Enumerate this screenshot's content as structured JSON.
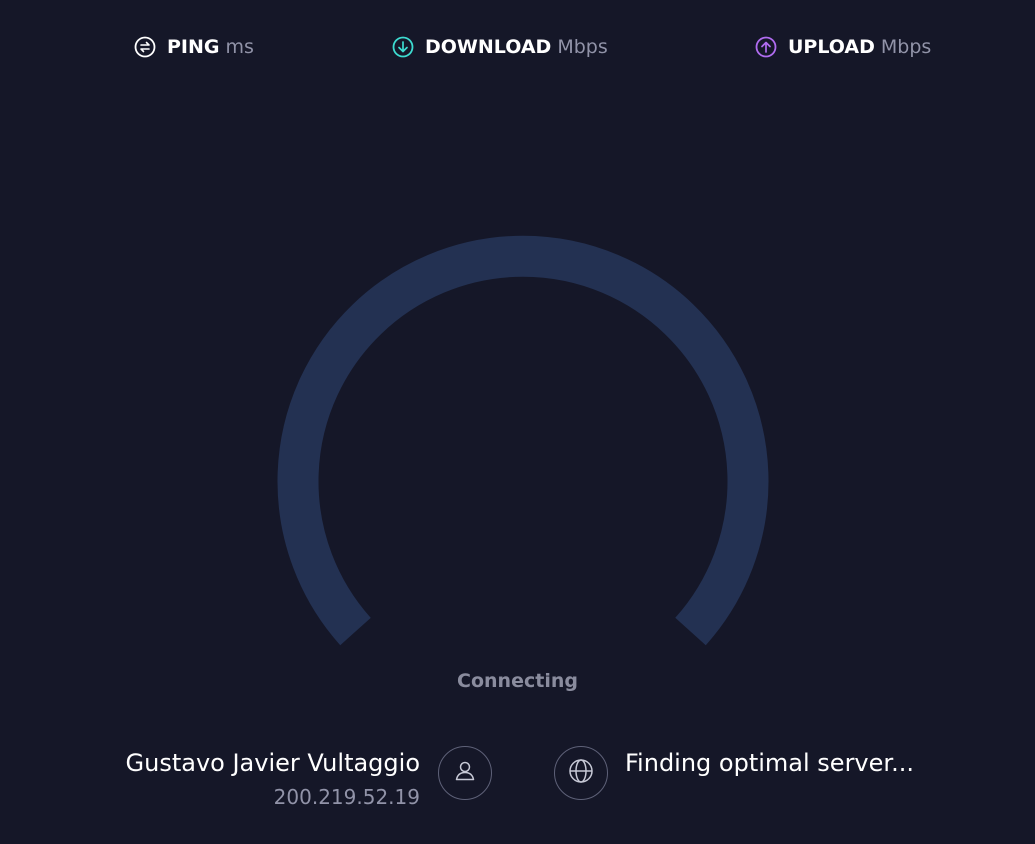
{
  "metrics": {
    "ping": {
      "label": "PING",
      "unit": "ms",
      "icon": "ping-icon",
      "color": "#ffffff"
    },
    "download": {
      "label": "DOWNLOAD",
      "unit": "Mbps",
      "icon": "download-icon",
      "color": "#3ddbd0"
    },
    "upload": {
      "label": "UPLOAD",
      "unit": "Mbps",
      "icon": "upload-icon",
      "color": "#b06cf0"
    }
  },
  "gauge": {
    "track_color": "#233152",
    "status": "Connecting"
  },
  "connection": {
    "isp_name": "Gustavo Javier Vultaggio",
    "ip_address": "200.219.52.19",
    "user_icon": "user-icon",
    "server_icon": "globe-icon",
    "server_status": "Finding optimal server..."
  },
  "colors": {
    "background": "#151728",
    "muted_text": "#9193a8"
  }
}
